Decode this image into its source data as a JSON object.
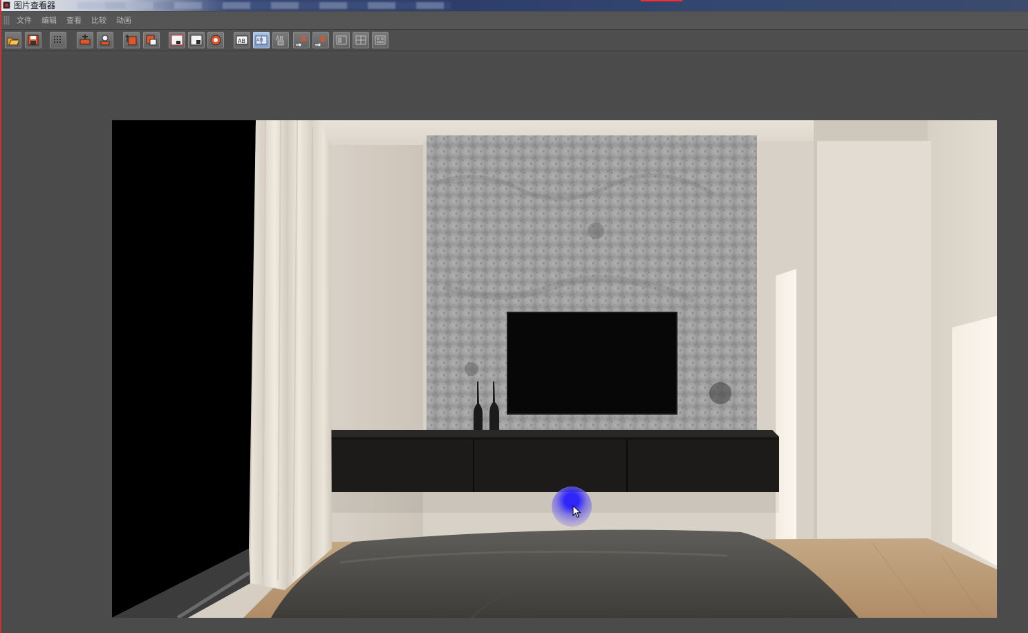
{
  "window": {
    "title": "图片查看器",
    "title_bar_accent": "#2d3e6b",
    "border_accent": "#c8323a"
  },
  "menu": {
    "items": [
      {
        "label": "文件"
      },
      {
        "label": "编辑"
      },
      {
        "label": "查看"
      },
      {
        "label": "比较"
      },
      {
        "label": "动画"
      }
    ]
  },
  "toolbar": {
    "buttons": [
      {
        "name": "open-icon"
      },
      {
        "name": "save-icon"
      },
      {
        "name": "channels-icon"
      },
      {
        "name": "track-icon"
      },
      {
        "name": "stamp-icon"
      },
      {
        "name": "history-up-icon"
      },
      {
        "name": "history-down-icon"
      },
      {
        "name": "region-render-icon"
      },
      {
        "name": "crop-render-icon"
      },
      {
        "name": "render-icon"
      },
      {
        "name": "ab-single-icon"
      },
      {
        "name": "ab-split-icon",
        "active": true
      },
      {
        "name": "ab-compare-icon"
      },
      {
        "name": "set-a-icon",
        "label": "A"
      },
      {
        "name": "set-b-icon",
        "label": "B"
      },
      {
        "name": "layout-1-icon"
      },
      {
        "name": "layout-2-icon"
      },
      {
        "name": "layout-3-icon"
      }
    ]
  },
  "viewer": {
    "image": "bedroom-tv-wall-render",
    "background": "#4b4b4b"
  }
}
